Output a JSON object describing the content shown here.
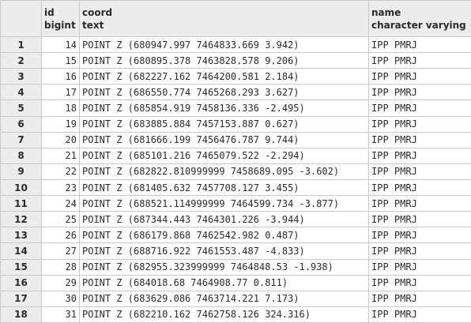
{
  "columns": [
    {
      "name": "id",
      "type": "bigint"
    },
    {
      "name": "coord",
      "type": "text"
    },
    {
      "name": "name",
      "type": "character varying"
    }
  ],
  "rows": [
    {
      "n": "1",
      "id": "14",
      "coord": "POINT Z (680947.997 7464833.669 3.942)",
      "name": "IPP PMRJ"
    },
    {
      "n": "2",
      "id": "15",
      "coord": "POINT Z (680895.378 7463828.578 9.206)",
      "name": "IPP PMRJ"
    },
    {
      "n": "3",
      "id": "16",
      "coord": "POINT Z (682227.162 7464200.581 2.184)",
      "name": "IPP PMRJ"
    },
    {
      "n": "4",
      "id": "17",
      "coord": "POINT Z (686550.774 7465268.293 3.627)",
      "name": "IPP PMRJ"
    },
    {
      "n": "5",
      "id": "18",
      "coord": "POINT Z (685854.919 7458136.336 -2.495)",
      "name": "IPP PMRJ"
    },
    {
      "n": "6",
      "id": "19",
      "coord": "POINT Z (683885.884 7457153.887 0.627)",
      "name": "IPP PMRJ"
    },
    {
      "n": "7",
      "id": "20",
      "coord": "POINT Z (681666.199 7456476.787 9.744)",
      "name": "IPP PMRJ"
    },
    {
      "n": "8",
      "id": "21",
      "coord": "POINT Z (685101.216 7465079.522 -2.294)",
      "name": "IPP PMRJ"
    },
    {
      "n": "9",
      "id": "22",
      "coord": "POINT Z (682822.810999999 7458689.095 -3.602)",
      "name": "IPP PMRJ"
    },
    {
      "n": "10",
      "id": "23",
      "coord": "POINT Z (681405.632 7457708.127 3.455)",
      "name": "IPP PMRJ"
    },
    {
      "n": "11",
      "id": "24",
      "coord": "POINT Z (688521.114999999 7464599.734 -3.877)",
      "name": "IPP PMRJ"
    },
    {
      "n": "12",
      "id": "25",
      "coord": "POINT Z (687344.443 7464301.226 -3.944)",
      "name": "IPP PMRJ"
    },
    {
      "n": "13",
      "id": "26",
      "coord": "POINT Z (686179.868 7462542.982 0.487)",
      "name": "IPP PMRJ"
    },
    {
      "n": "14",
      "id": "27",
      "coord": "POINT Z (688716.922 7461553.487 -4.833)",
      "name": "IPP PMRJ"
    },
    {
      "n": "15",
      "id": "28",
      "coord": "POINT Z (682955.323999999 7464848.53 -1.938)",
      "name": "IPP PMRJ"
    },
    {
      "n": "16",
      "id": "29",
      "coord": "POINT Z (684018.68 7464908.77 0.811)",
      "name": "IPP PMRJ"
    },
    {
      "n": "17",
      "id": "30",
      "coord": "POINT Z (683629.086 7463714.221 7.173)",
      "name": "IPP PMRJ"
    },
    {
      "n": "18",
      "id": "31",
      "coord": "POINT Z (682210.162 7462758.126 324.316)",
      "name": "IPP PMRJ"
    }
  ]
}
